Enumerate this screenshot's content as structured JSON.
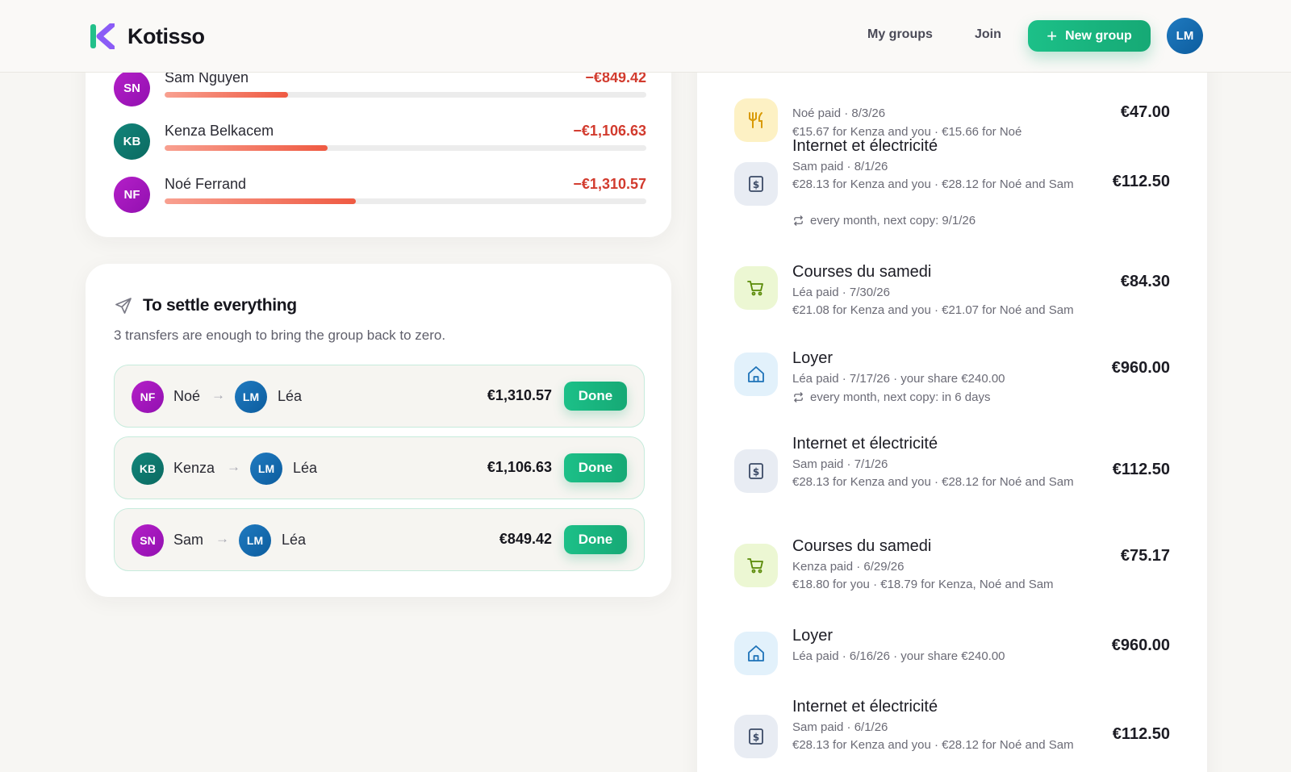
{
  "app": {
    "name": "Kotisso"
  },
  "nav": {
    "my_groups": "My groups",
    "join": "Join",
    "new_group": "New group",
    "user_initials": "LM"
  },
  "balances": [
    {
      "initials": "SN",
      "name": "Sam Nguyen",
      "amount": "−€849.42",
      "share": 0.257
    },
    {
      "initials": "KB",
      "name": "Kenza Belkacem",
      "amount": "−€1,106.63",
      "share": 0.338
    },
    {
      "initials": "NF",
      "name": "Noé Ferrand",
      "amount": "−€1,310.57",
      "share": 0.397
    }
  ],
  "settle": {
    "title": "To settle everything",
    "subtitle": "3 transfers are enough to bring the group back to zero.",
    "done_label": "Done",
    "arrow": "→",
    "transfers": [
      {
        "from_initials": "NF",
        "from": "Noé",
        "to_initials": "LM",
        "to": "Léa",
        "amount": "€1,310.57"
      },
      {
        "from_initials": "KB",
        "from": "Kenza",
        "to_initials": "LM",
        "to": "Léa",
        "amount": "€1,106.63"
      },
      {
        "from_initials": "SN",
        "from": "Sam",
        "to_initials": "LM",
        "to": "Léa",
        "amount": "€849.42"
      }
    ]
  },
  "expenses": [
    {
      "icon": "food-icon",
      "title": "",
      "paid": "Noé paid · 8/3/26",
      "split": "€15.67 for Kenza and you · €15.66 for Noé",
      "recur": "",
      "amount": "€47.00"
    },
    {
      "icon": "bill-icon",
      "title": "Internet et électricité",
      "paid": "Sam paid · 8/1/26",
      "split": "€28.13 for Kenza and you · €28.12 for Noé and Sam",
      "recur": "every month, next copy: 9/1/26",
      "amount": "€112.50"
    },
    {
      "icon": "cart-icon",
      "title": "Courses du samedi",
      "paid": "Léa paid · 7/30/26",
      "split": "€21.08 for Kenza and you · €21.07 for Noé and Sam",
      "recur": "",
      "amount": "€84.30"
    },
    {
      "icon": "home-icon",
      "title": "Loyer",
      "paid": "Léa paid · 7/17/26 · your share €240.00",
      "split": "",
      "recur": "every month, next copy: in 6 days",
      "amount": "€960.00"
    },
    {
      "icon": "bill-icon",
      "title": "Internet et électricité",
      "paid": "Sam paid · 7/1/26",
      "split": "€28.13 for Kenza and you · €28.12 for Noé and Sam",
      "recur": "",
      "amount": "€112.50"
    },
    {
      "icon": "cart-icon",
      "title": "Courses du samedi",
      "paid": "Kenza paid · 6/29/26",
      "split": "€18.80 for you · €18.79 for Kenza, Noé and Sam",
      "recur": "",
      "amount": "€75.17"
    },
    {
      "icon": "home-icon",
      "title": "Loyer",
      "paid": "Léa paid · 6/16/26 · your share €240.00",
      "split": "",
      "recur": "",
      "amount": "€960.00"
    },
    {
      "icon": "bill-icon",
      "title": "Internet et électricité",
      "paid": "Sam paid · 6/1/26",
      "split": "€28.13 for Kenza and you · €28.12 for Noé and Sam",
      "recur": "",
      "amount": "€112.50"
    }
  ],
  "colors": {
    "accent": "#1cc088",
    "negative": "#d23b2e",
    "brand_purple": "#8b5cf6"
  }
}
